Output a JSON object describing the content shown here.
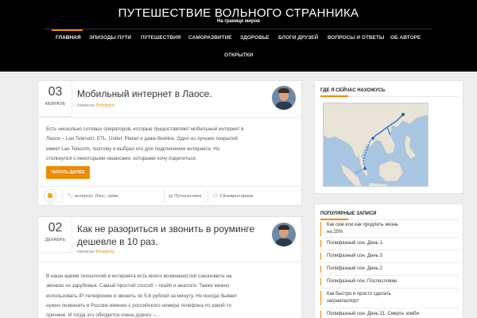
{
  "site": {
    "title": "ПУТЕШЕСТВИЕ ВОЛЬНОГО СТРАННИКА",
    "tagline": "На границе миров"
  },
  "nav": {
    "items": [
      "ГЛАВНАЯ",
      "ЭПИЗОДЫ ПУТИ",
      "ПУТЕШЕСТВИЯ",
      "САМОРАЗВИТИЕ",
      "ЗДОРОВЬЕ",
      "БЛОГИ ДРУЗЕЙ",
      "ВОПРОСЫ И ОТВЕТЫ",
      "ОБ АВТОРЕ",
      "ОТКРЫТКИ"
    ],
    "active": "ГЛАВНАЯ"
  },
  "posts": [
    {
      "day": "03",
      "month": "ФЕВРАЛЬ",
      "title": "Мобильный интернет в Лаосе.",
      "byline_prefix": "Написал",
      "author": "Pelegrino",
      "excerpt_lines": [
        "Есть несколько сотовых операторов, которые предоставляют мобильный интернет в",
        "Лаосе – Lao Telecom, ETL, Unitel, Planet и даже Beeline. Одно из лучших покрытий",
        "имеет Lao Telecom, поэтому я выбрал его для подключения интернета. Но",
        "столкнулся с некоторыми нюансами, которыми хочу поделиться."
      ],
      "read_more": "ЧИТАТЬ ДАЛЕЕ",
      "tags": "интернет, Лаос, связь",
      "category": "Путешествия",
      "comments": "2 Комментариев"
    },
    {
      "day": "02",
      "month": "ДЕКАБРЬ",
      "title_lines": [
        "Как не разориться и звонить в роуминге",
        "дешевле в 10 раз."
      ],
      "byline_prefix": "Написал",
      "author": "Pelegrino",
      "excerpt_lines": [
        "В наше время технологий и интернета есть много возможностей сэкономить на",
        "звонках из зарубежья. Самый простой способ – скайп и аналоги. Также можно",
        "использовать IP-телефонию и звонить по 5-6 рублей за минуту. Но иногда бывает",
        "нужно позвонить в Россию именно с российского номера телефона по какой-то",
        "причине. И тогда это обходится очень дорого –..."
      ]
    }
  ],
  "sidebar": {
    "location_title": "ГДЕ Я СЕЙЧАС НАХОЖУСЬ",
    "popular_title": "ПОПУЛЯРНЫЕ ЗАПИСИ",
    "popular": [
      [
        "Как сим или как продлить жизнь",
        "на 25%"
      ],
      [
        "Полифазный сон. День 1."
      ],
      [
        "Полифазный сон. День 3"
      ],
      [
        "Полифазный сон. День 2"
      ],
      [
        "Полифазный сон. Послесловие."
      ],
      [
        "Как быстро и просто сделать",
        "загранпаспорт"
      ],
      [
        "Полифазный сон. День 21. Смерть зомби"
      ]
    ]
  },
  "colors": {
    "accent": "#f08a00",
    "header_bg": "#000000",
    "page_bg": "#eeeeee"
  },
  "icons": {
    "tags": "tag-icon",
    "category": "folder-icon",
    "comments": "comments-icon",
    "sticky": "pin-icon"
  }
}
